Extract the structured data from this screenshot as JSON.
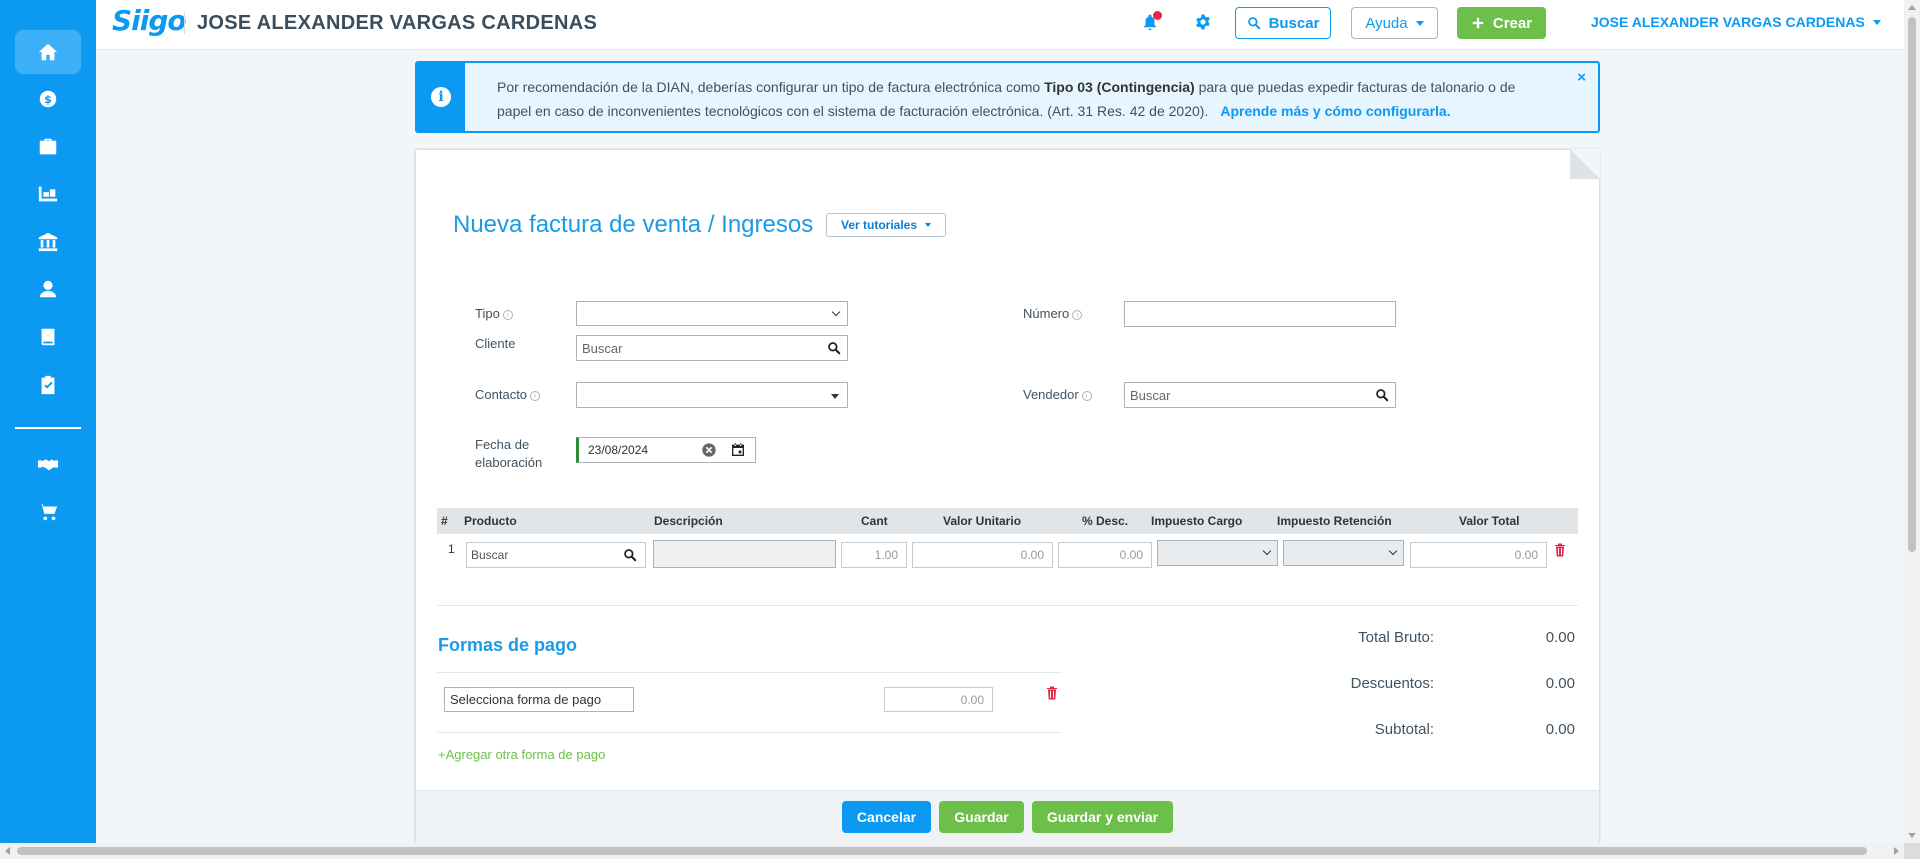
{
  "header": {
    "logo": "Siigo",
    "company": "JOSE ALEXANDER VARGAS CARDENAS",
    "search_label": "Buscar",
    "help_label": "Ayuda",
    "create_label": "Crear",
    "user_name": "JOSE ALEXANDER VARGAS CARDENAS"
  },
  "banner": {
    "text_pre": "Por recomendación de la DIAN, deberías configurar un tipo de factura electrónica como ",
    "text_bold": "Tipo 03 (Contingencia)",
    "text_post": " para que puedas expedir facturas de talonario o de papel en caso de inconvenientes tecnológicos con el sistema de facturación electrónica. (Art. 31 Res. 42 de 2020).",
    "link": "Aprende más y cómo configurarla.",
    "close": "×"
  },
  "form": {
    "title": "Nueva factura de venta / Ingresos",
    "tutorials_label": "Ver tutoriales",
    "tipo_label": "Tipo",
    "tipo_value": "",
    "numero_label": "Número",
    "numero_value": "",
    "cliente_label": "Cliente",
    "cliente_placeholder": "Buscar",
    "contacto_label": "Contacto",
    "contacto_value": "",
    "vendedor_label": "Vendedor",
    "vendedor_placeholder": "Buscar",
    "fecha_label_1": "Fecha de",
    "fecha_label_2": "elaboración",
    "fecha_value": "23/08/2024"
  },
  "items_table": {
    "columns": [
      "#",
      "Producto",
      "Descripción",
      "Cant",
      "Valor Unitario",
      "% Desc.",
      "Impuesto Cargo",
      "Impuesto Retención",
      "Valor Total"
    ],
    "rows": [
      {
        "num": "1",
        "producto": "Buscar",
        "descripcion": "",
        "cant": "1.00",
        "valor_unitario": "0.00",
        "desc": "0.00",
        "impuesto_cargo": "",
        "impuesto_retencion": "",
        "valor_total": "0.00"
      }
    ]
  },
  "payment": {
    "title": "Formas de pago",
    "method_value": "Selecciona forma de pago",
    "amount": "0.00",
    "add_label": "+Agregar otra forma de pago"
  },
  "totals": {
    "bruto_label": "Total Bruto:",
    "bruto_value": "0.00",
    "descuentos_label": "Descuentos:",
    "descuentos_value": "0.00",
    "subtotal_label": "Subtotal:",
    "subtotal_value": "0.00"
  },
  "footer": {
    "cancel_label": "Cancelar",
    "save_label": "Guardar",
    "save_send_label": "Guardar y enviar"
  },
  "sidebar": {
    "items": [
      "home-icon",
      "dollar-icon",
      "briefcase-icon",
      "warehouse-icon",
      "bank-icon",
      "user-icon",
      "book-icon",
      "clipboard-check-icon",
      "handshake-icon",
      "cart-icon"
    ]
  },
  "colors": {
    "brand_blue": "#0b99f2",
    "green": "#6cc04a",
    "danger": "#e0284a"
  }
}
